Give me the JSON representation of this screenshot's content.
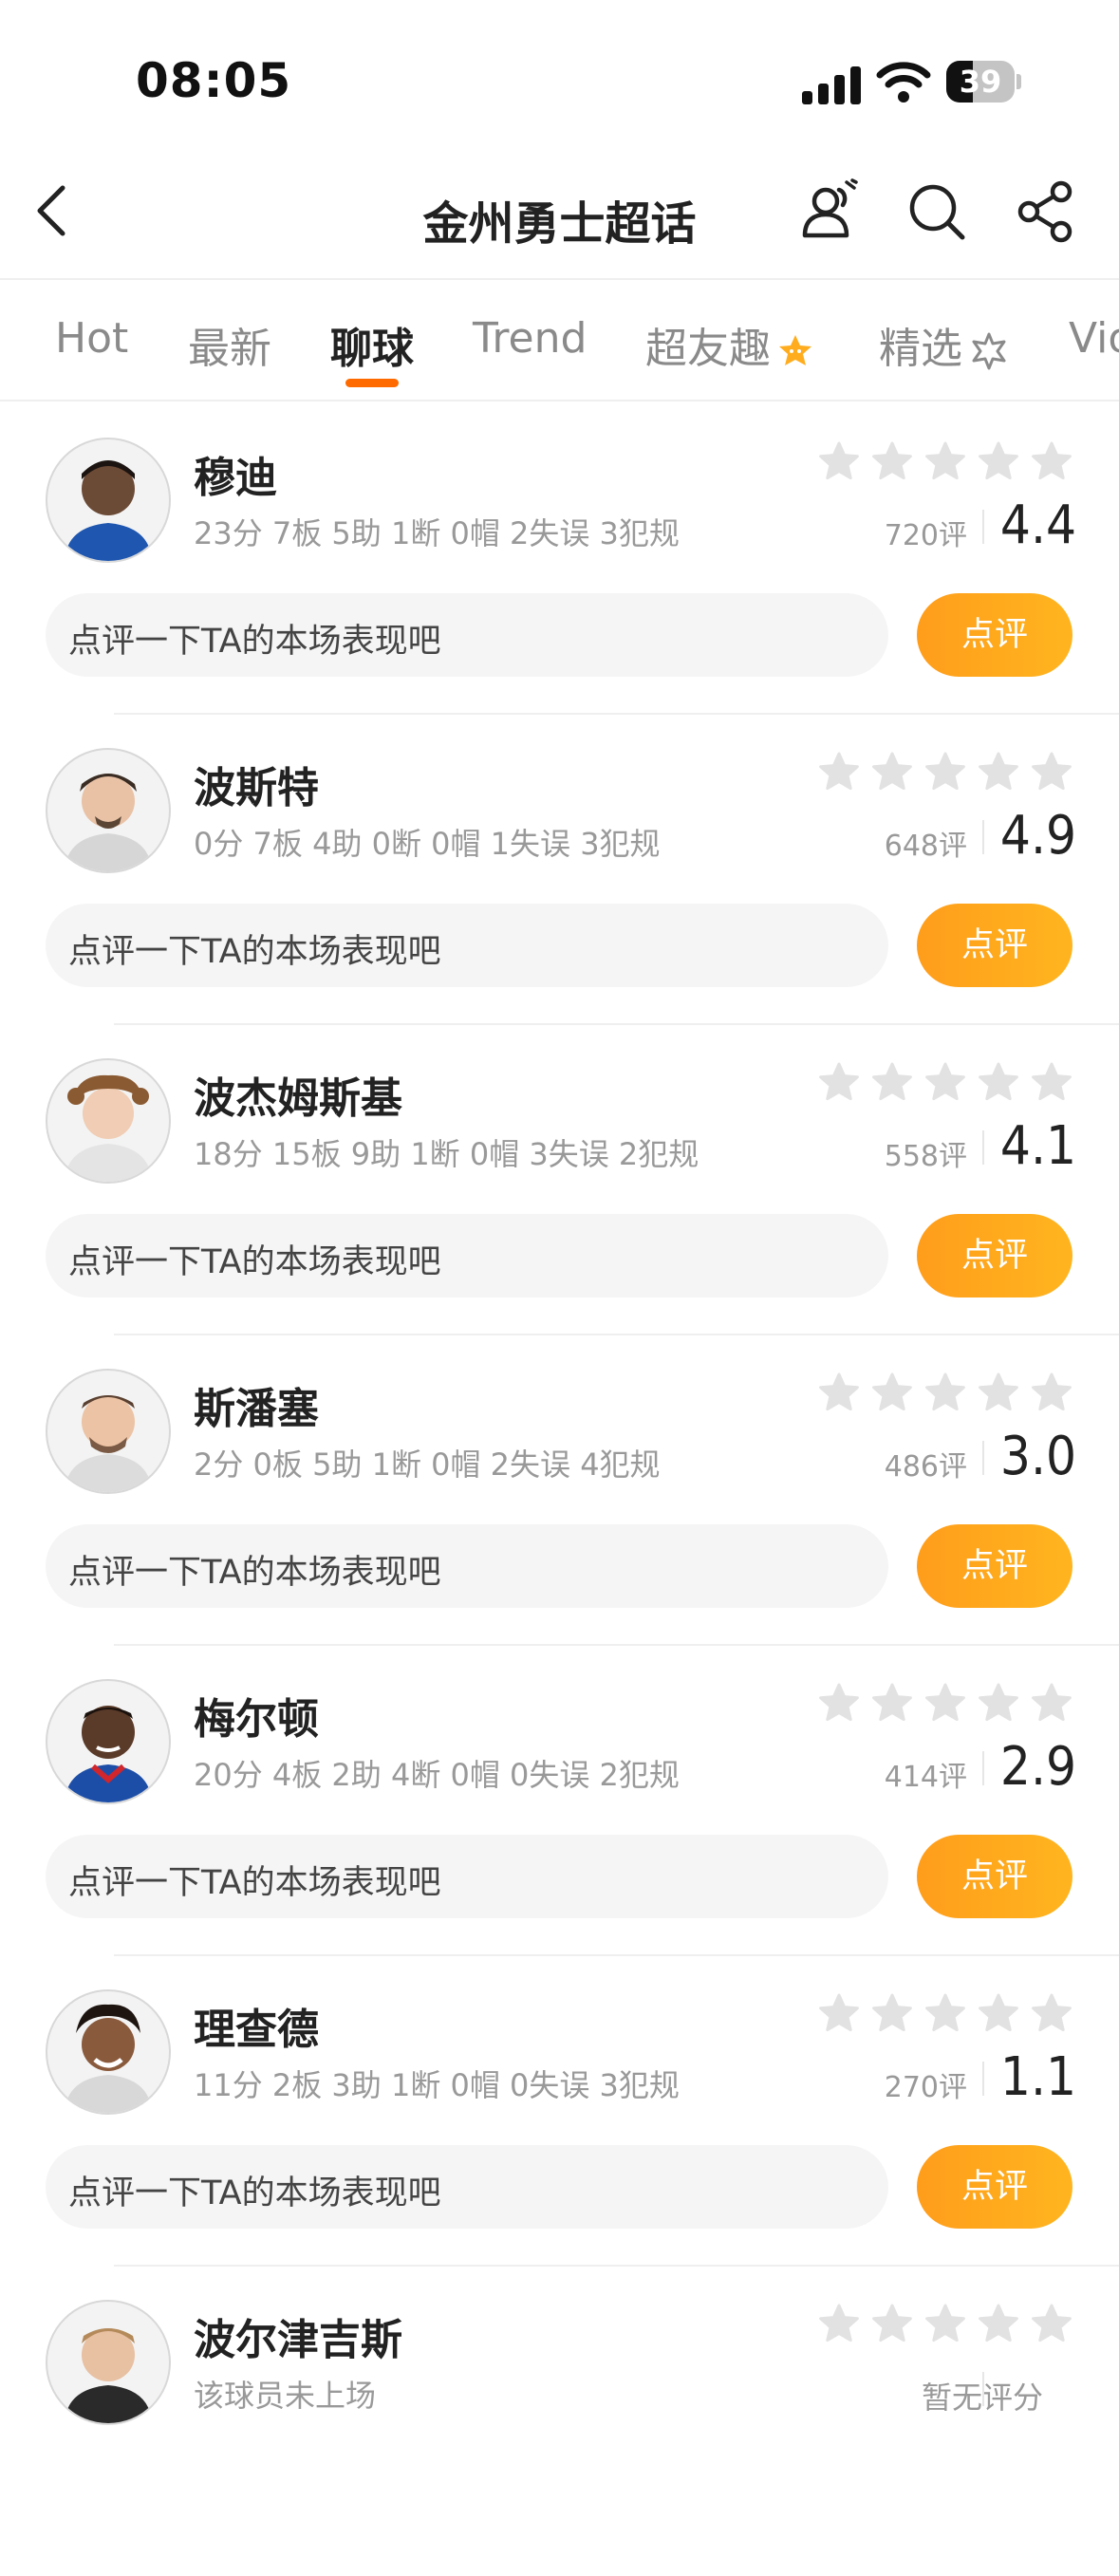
{
  "status_bar": {
    "time": "08:05",
    "battery": "39",
    "battery_level": 0.39
  },
  "header": {
    "title": "金州勇士超话",
    "icons": [
      "back-icon",
      "people-icon",
      "search-icon",
      "share-icon"
    ]
  },
  "tabs": [
    {
      "label": "Hot",
      "active": false
    },
    {
      "label": "最新",
      "active": false
    },
    {
      "label": "聊球",
      "active": true
    },
    {
      "label": "Trend",
      "active": false
    },
    {
      "label": "超友趣",
      "active": false,
      "badge_icon": "star-badge-icon"
    },
    {
      "label": "精选",
      "active": false,
      "badge_icon": "starburst-icon"
    },
    {
      "label": "Vio",
      "active": false
    }
  ],
  "colors": {
    "accent": "#ff6a00",
    "button": "#ffa51d",
    "star_empty": "#e2e2e2"
  },
  "comment_placeholder": "点评一下TA的本场表现吧",
  "rate_button_label": "点评",
  "players": [
    {
      "name": "穆迪",
      "stats": "23分 7板 5助 1断 0帽 2失误 3犯规",
      "ratings_count": "720评",
      "score": "4.4"
    },
    {
      "name": "波斯特",
      "stats": "0分 7板 4助 0断 0帽 1失误 3犯规",
      "ratings_count": "648评",
      "score": "4.9"
    },
    {
      "name": "波杰姆斯基",
      "stats": "18分 15板 9助 1断 0帽 3失误 2犯规",
      "ratings_count": "558评",
      "score": "4.1"
    },
    {
      "name": "斯潘塞",
      "stats": "2分 0板 5助 1断 0帽 2失误 4犯规",
      "ratings_count": "486评",
      "score": "3.0"
    },
    {
      "name": "梅尔顿",
      "stats": "20分 4板 2助 4断 0帽 0失误 2犯规",
      "ratings_count": "414评",
      "score": "2.9"
    },
    {
      "name": "理查德",
      "stats": "11分 2板 3助 1断 0帽 0失误 3犯规",
      "ratings_count": "270评",
      "score": "1.1"
    },
    {
      "name": "波尔津吉斯",
      "stats": "该球员未上场",
      "no_score": "暂无评分"
    }
  ]
}
